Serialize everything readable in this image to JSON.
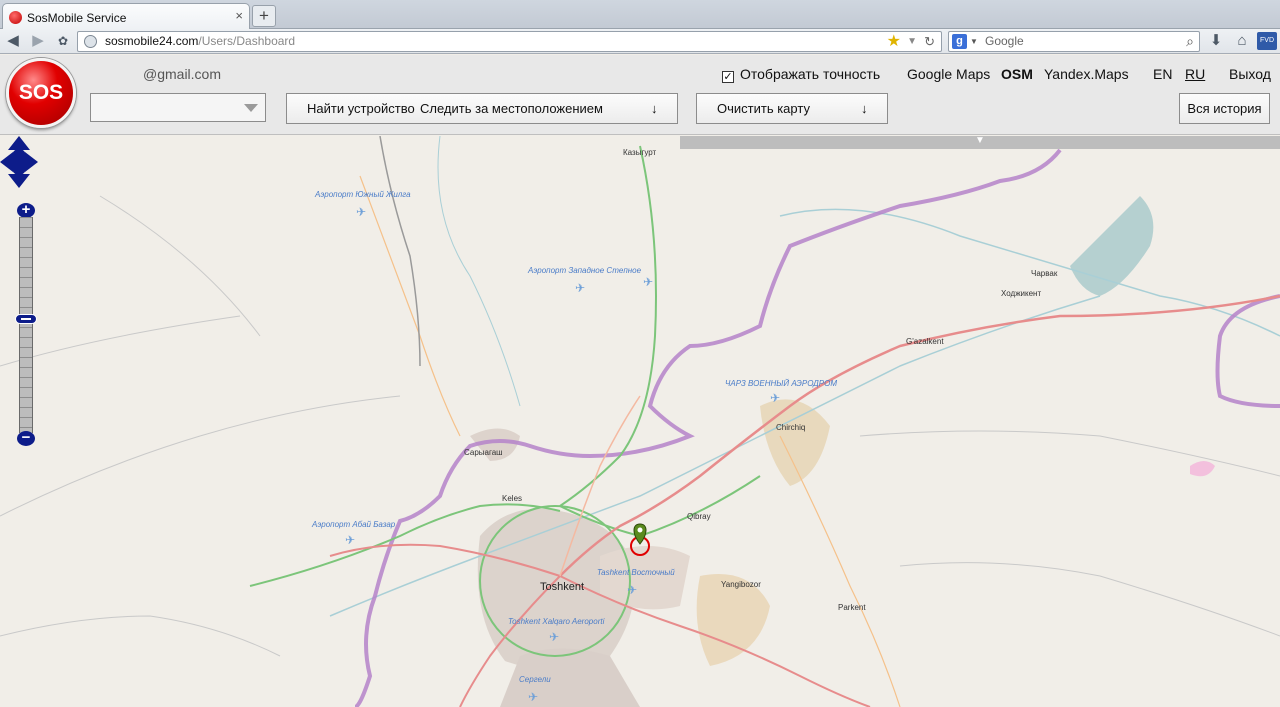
{
  "browser": {
    "tab_title": "SosMobile Service",
    "new_tab": "+",
    "url_host": "sosmobile24.com",
    "url_path": "/Users/Dashboard",
    "search_placeholder": "Google"
  },
  "header": {
    "logo_text": "SOS",
    "email": "@gmail.com",
    "device_select_value": "",
    "find_device": "Найти устройство",
    "track_location": "Следить за местоположением",
    "dropdown_arrow": "↓",
    "clear_map": "Очистить карту",
    "show_accuracy": "Отображать точность",
    "show_accuracy_checked": true,
    "map_types": [
      "Google Maps",
      "OSM",
      "Yandex.Maps"
    ],
    "active_map_type": "OSM",
    "languages": [
      "EN",
      "RU"
    ],
    "active_language": "RU",
    "logout": "Выход",
    "full_history": "Вся история"
  },
  "map": {
    "zoom_level_fraction": 0.47,
    "place_labels": [
      "Казыгурт",
      "Чарвак",
      "Ходжикент",
      "G'azalkent",
      "Chirchiq",
      "Сарыагаш",
      "Keles",
      "Qibray",
      "Yangibozor",
      "Parkent",
      "Toshkent"
    ],
    "airport_labels": [
      "Аэропорт Южный Жилга",
      "Аэропорт Западное Степное",
      "ЧАРЗ ВОЕННЫЙ АЭРОДРОМ",
      "Аэропорт Абай Базар",
      "Tashkent Восточный",
      "Toshkent Xalqaro Aeroporti",
      "Сергели"
    ]
  }
}
